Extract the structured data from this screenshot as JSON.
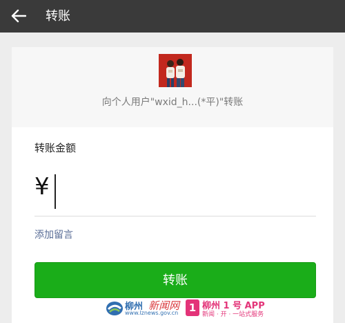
{
  "header": {
    "title": "转账",
    "back_icon": "arrow-left-icon"
  },
  "recipient": {
    "text": "向个人用户\"wxid_h...(*平)\"转账",
    "avatar": "user-avatar-photo"
  },
  "amount": {
    "label": "转账金额",
    "currency_symbol": "¥",
    "value": "",
    "placeholder": ""
  },
  "note": {
    "link_label": "添加留言"
  },
  "actions": {
    "transfer_label": "转账",
    "transfer_color": "#1aad19"
  },
  "watermark": {
    "site1_name": "柳州",
    "site1_name_b": "新闻网",
    "site1_url": "www.lznews.gov.cn",
    "site2_logo": "1",
    "site2_name": "柳州 1 号 APP",
    "site2_slogan": "新闻 · 开 · 一站式服务"
  },
  "colors": {
    "topbar": "#3a3a3a",
    "background": "#ededed",
    "link": "#576b95",
    "avatar_bg": "#c2281e"
  }
}
